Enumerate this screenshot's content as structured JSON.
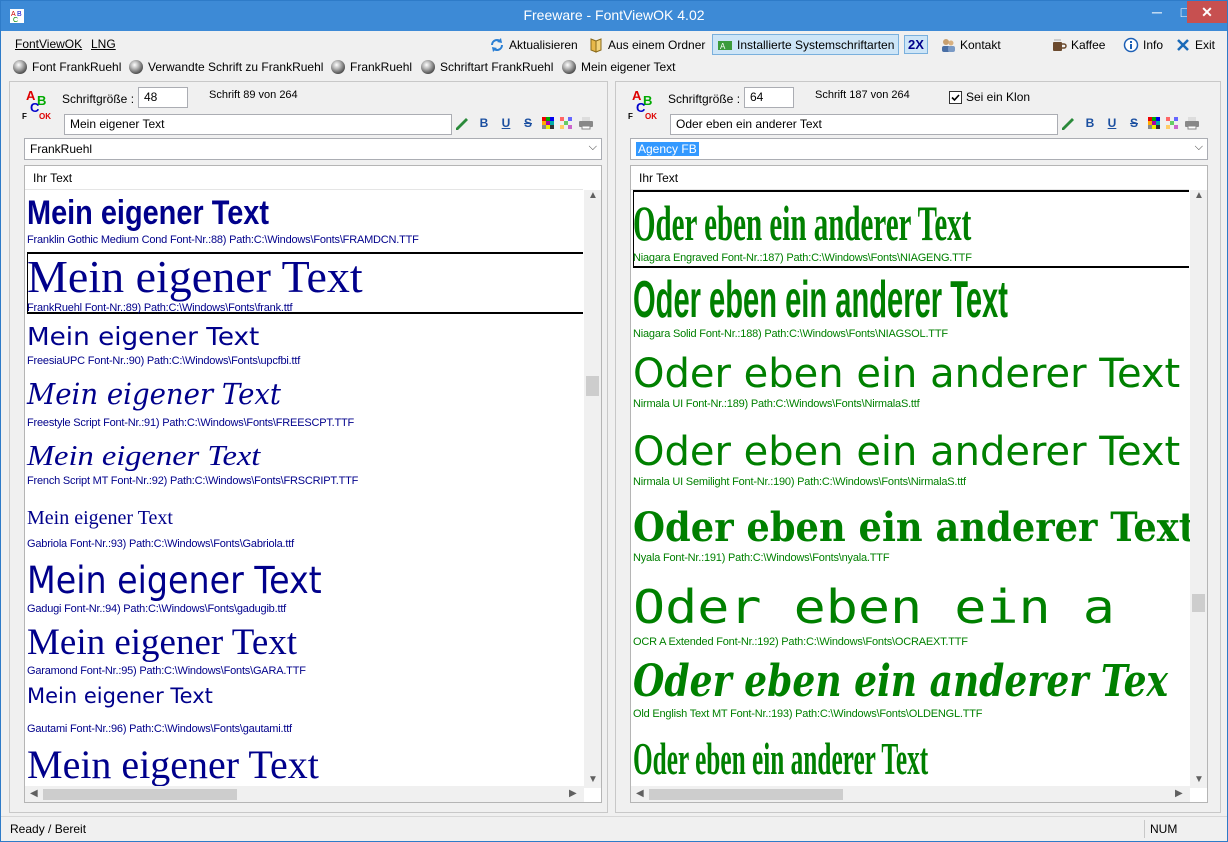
{
  "window": {
    "title": "Freeware - FontViewOK 4.02",
    "minimize": "─",
    "maximize": "□",
    "close": "✕"
  },
  "menu": {
    "items": [
      "FontViewOK",
      "LNG"
    ]
  },
  "toolbar": {
    "refresh": "Aktualisieren",
    "from_folder": "Aus einem Ordner",
    "installed": "Installierte Systemschriftarten",
    "zoom": "2X",
    "contact": "Kontakt",
    "coffee": "Kaffee",
    "info": "Info",
    "exit": "Exit"
  },
  "quickbar": [
    "Font FrankRuehl",
    "Verwandte Schrift zu FrankRuehl",
    "FrankRuehl",
    "Schriftart FrankRuehl",
    "Mein eigener Text"
  ],
  "left": {
    "size_label": "Schriftgröße :",
    "size_value": "48",
    "count": "Schrift 89 von 264",
    "text_value": "Mein eigener Text",
    "font_select": "FrankRuehl",
    "list_header": "Ihr Text",
    "sample_color": "#00008b",
    "items": [
      {
        "sample": "Mein eigener Text",
        "info": "Franklin Gothic Medium Cond Font-Nr.:88) Path:C:\\Windows\\Fonts\\FRAMDCN.TTF"
      },
      {
        "sample": "Mein eigener Text",
        "info": "FrankRuehl Font-Nr.:89) Path:C:\\Windows\\Fonts\\frank.ttf"
      },
      {
        "sample": "Mein eigener Text",
        "info": "FreesiaUPC Font-Nr.:90) Path:C:\\Windows\\Fonts\\upcfbi.ttf"
      },
      {
        "sample": "Mein eigener Text",
        "info": "Freestyle Script Font-Nr.:91) Path:C:\\Windows\\Fonts\\FREESCPT.TTF"
      },
      {
        "sample": "Mein eigener Text",
        "info": "French Script MT Font-Nr.:92) Path:C:\\Windows\\Fonts\\FRSCRIPT.TTF"
      },
      {
        "sample": "Mein eigener Text",
        "info": "Gabriola Font-Nr.:93) Path:C:\\Windows\\Fonts\\Gabriola.ttf"
      },
      {
        "sample": "Mein eigener Text",
        "info": "Gadugi Font-Nr.:94) Path:C:\\Windows\\Fonts\\gadugib.ttf"
      },
      {
        "sample": "Mein eigener Text",
        "info": "Garamond Font-Nr.:95) Path:C:\\Windows\\Fonts\\GARA.TTF"
      },
      {
        "sample": "Mein eigener Text",
        "info": "Gautami Font-Nr.:96) Path:C:\\Windows\\Fonts\\gautami.ttf"
      },
      {
        "sample": "Mein eigener Text",
        "info": ""
      }
    ]
  },
  "right": {
    "size_label": "Schriftgröße :",
    "size_value": "64",
    "count": "Schrift 187 von 264",
    "clone_label": "Sei ein Klon",
    "text_value": "Oder eben ein anderer Text",
    "font_select": "Agency FB",
    "list_header": "Ihr Text",
    "sample_color": "#008000",
    "items": [
      {
        "sample": "Oder eben ein anderer Text",
        "info": "Niagara Engraved Font-Nr.:187) Path:C:\\Windows\\Fonts\\NIAGENG.TTF"
      },
      {
        "sample": "Oder eben ein anderer Text",
        "info": "Niagara Solid Font-Nr.:188) Path:C:\\Windows\\Fonts\\NIAGSOL.TTF"
      },
      {
        "sample": "Oder eben ein anderer Text",
        "info": "Nirmala UI Font-Nr.:189) Path:C:\\Windows\\Fonts\\NirmalaS.ttf"
      },
      {
        "sample": "Oder eben ein anderer Text",
        "info": "Nirmala UI Semilight Font-Nr.:190) Path:C:\\Windows\\Fonts\\NirmalaS.ttf"
      },
      {
        "sample": "Oder eben ein anderer Text",
        "info": "Nyala Font-Nr.:191) Path:C:\\Windows\\Fonts\\nyala.TTF"
      },
      {
        "sample": "Oder eben ein a",
        "info": "OCR A Extended Font-Nr.:192) Path:C:\\Windows\\Fonts\\OCRAEXT.TTF"
      },
      {
        "sample": "Oder eben ein anderer Tex",
        "info": "Old English Text MT Font-Nr.:193) Path:C:\\Windows\\Fonts\\OLDENGL.TTF"
      },
      {
        "sample": "Oder eben ein anderer Text",
        "info": ""
      }
    ]
  },
  "status": {
    "text": "Ready / Bereit",
    "num": "NUM"
  }
}
